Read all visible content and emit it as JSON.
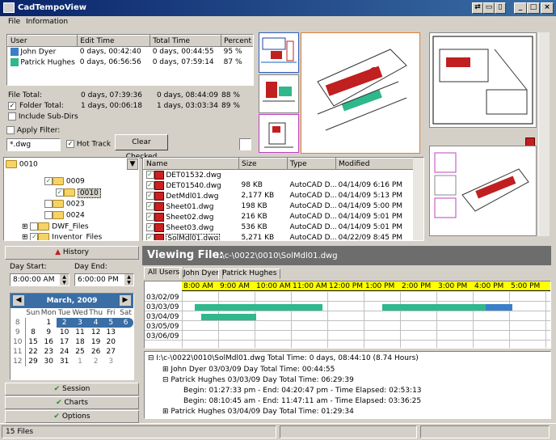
{
  "app_title": "CadTempoView",
  "menu": [
    "File",
    "Information"
  ],
  "users_table": {
    "headers": [
      "User",
      "Edit Time",
      "Total Time",
      "Percent"
    ],
    "rows": [
      {
        "user": "John Dyer",
        "color": "#3a7fc8",
        "edit": "0 days, 00:42:40",
        "total": "0 days, 00:44:55",
        "pct": "95 %"
      },
      {
        "user": "Patrick Hughes",
        "color": "#2fb88c",
        "edit": "0 days, 06:56:56",
        "total": "0 days, 07:59:14",
        "pct": "87 %"
      }
    ]
  },
  "file_total": {
    "label": "File Total:",
    "edit": "0 days, 07:39:36",
    "total": "0 days, 08:44:09",
    "pct": "88 %"
  },
  "folder_total": {
    "label": "Folder Total:",
    "edit": "1 days, 00:06:18",
    "total": "1 days, 03:03:34",
    "pct": "89 %"
  },
  "include_subdirs": "Include Sub-Dirs",
  "apply_filter": "Apply Filter:",
  "filter_value": "*.dwg",
  "hot_track": "Hot Track",
  "clear_checked": "Clear Checked",
  "tree": [
    {
      "label": "0010",
      "indent": 0,
      "check": false
    },
    {
      "label": "0009",
      "indent": 3,
      "check": true
    },
    {
      "label": "0010",
      "indent": 3,
      "check": true,
      "selected": true
    },
    {
      "label": "0023",
      "indent": 2,
      "check": false
    },
    {
      "label": "0024",
      "indent": 2,
      "check": false
    },
    {
      "label": "DWF_Files",
      "indent": 1,
      "check": false
    },
    {
      "label": "Inventor_Files",
      "indent": 1,
      "check": true
    }
  ],
  "files_table": {
    "headers": [
      "Name",
      "Size",
      "Type",
      "Modified"
    ],
    "rows": [
      {
        "name": "DET01532.dwg",
        "size": "",
        "type": "",
        "mod": ""
      },
      {
        "name": "DET01540.dwg",
        "size": "98 KB",
        "type": "AutoCAD D...",
        "mod": "04/14/09 6:16 PM"
      },
      {
        "name": "DetMdl01.dwg",
        "size": "2,177 KB",
        "type": "AutoCAD D...",
        "mod": "04/14/09 5:13 PM"
      },
      {
        "name": "Sheet01.dwg",
        "size": "198 KB",
        "type": "AutoCAD D...",
        "mod": "04/14/09 5:00 PM"
      },
      {
        "name": "Sheet02.dwg",
        "size": "216 KB",
        "type": "AutoCAD D...",
        "mod": "04/14/09 5:01 PM"
      },
      {
        "name": "Sheet03.dwg",
        "size": "536 KB",
        "type": "AutoCAD D...",
        "mod": "04/14/09 5:01 PM"
      },
      {
        "name": "SolMdl01.dwg",
        "size": "5,271 KB",
        "type": "AutoCAD D...",
        "mod": "04/22/09 8:45 PM"
      }
    ]
  },
  "history_btn": "History",
  "day_start_label": "Day Start:",
  "day_end_label": "Day End:",
  "day_start": "8:00:00 AM",
  "day_end": "6:00:00 PM",
  "calendar": {
    "title": "March, 2009",
    "days": [
      "Sun",
      "Mon",
      "Tue",
      "Wed",
      "Thu",
      "Fri",
      "Sat"
    ],
    "weeks": [
      [
        "8",
        "1",
        "2",
        "3",
        "4",
        "5",
        "6"
      ],
      [
        "9",
        "8",
        "9",
        "10",
        "11",
        "12",
        "13"
      ],
      [
        "10",
        "15",
        "16",
        "17",
        "18",
        "19",
        "20"
      ],
      [
        "11",
        "22",
        "23",
        "24",
        "25",
        "26",
        "27"
      ],
      [
        "12",
        "29",
        "30",
        "31",
        "1",
        "2",
        "3"
      ]
    ],
    "pre": "8"
  },
  "session_btn": "Session",
  "charts_btn": "Charts",
  "options_btn": "Options",
  "viewing_label": "Viewing File:",
  "viewing_path": "I:\\c-\\0022\\0010\\SolMdl01.dwg",
  "tabs": [
    "All Users",
    "John Dyer",
    "Patrick Hughes"
  ],
  "hours": [
    "8:00 AM",
    "9:00 AM",
    "10:00 AM",
    "11:00 AM",
    "12:00 PM",
    "1:00 PM",
    "2:00 PM",
    "3:00 PM",
    "4:00 PM",
    "5:00 PM"
  ],
  "dates": [
    "03/02/09",
    "03/03/09",
    "03/04/09",
    "03/05/09",
    "03/06/09"
  ],
  "log": {
    "root": "I:\\c-\\0022\\0010\\SolMdl01.dwg  Total Time: 0 days, 08:44:10 (8.74 Hours)",
    "lines": [
      "John Dyer  03/03/09   Day Total Time: 00:44:55",
      "Patrick Hughes  03/03/09   Day Total Time: 06:29:39",
      "Begin:  01:27:33 pm  -  End:  04:20:47 pm - Time Elapsed:  02:53:13",
      "Begin:  08:10:45 am  -  End:  11:47:11 am - Time Elapsed:  03:36:25",
      "Patrick Hughes  03/04/09   Day Total Time: 01:29:34"
    ]
  },
  "status": "15 Files"
}
